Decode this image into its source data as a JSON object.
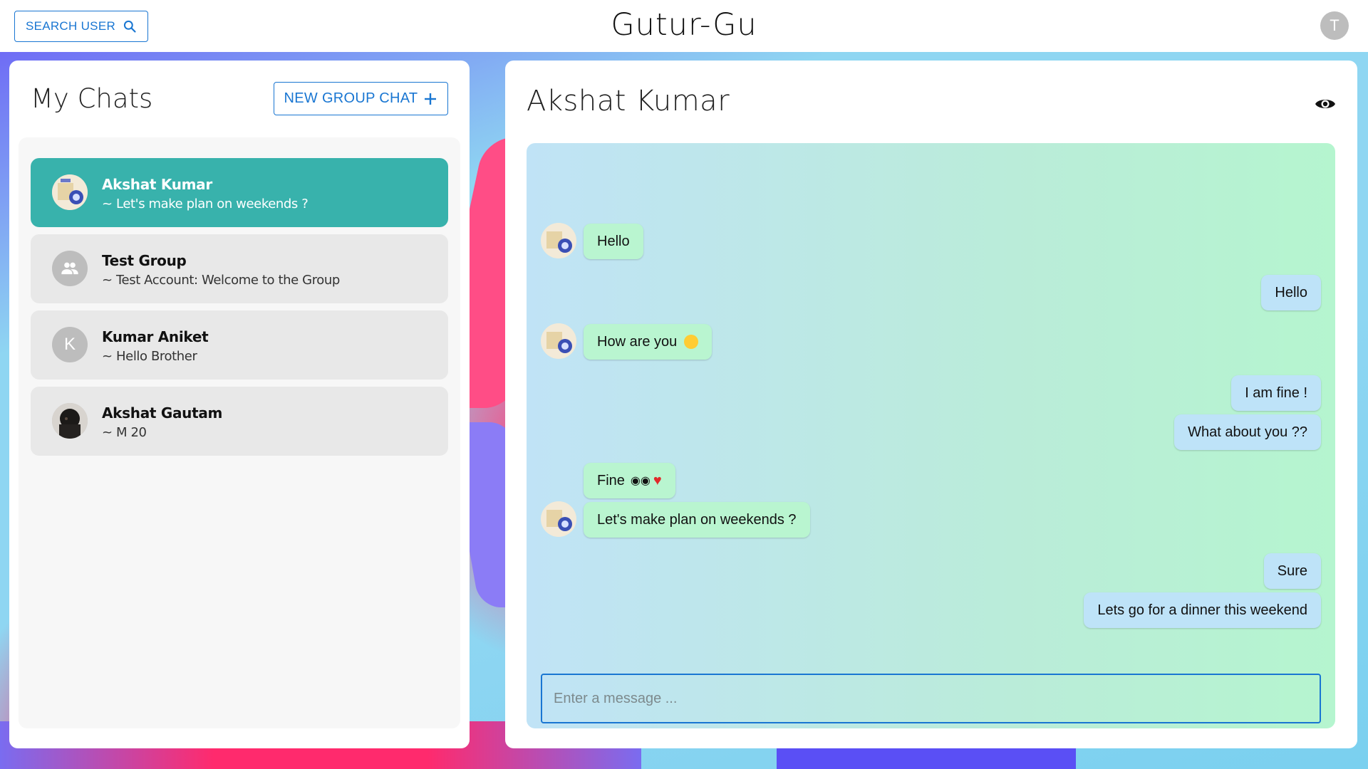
{
  "topbar": {
    "search_button_label": "SEARCH USER",
    "app_title": "Gutur-Gu",
    "user_avatar_initial": "T"
  },
  "sidebar": {
    "title": "My Chats",
    "new_group_button_label": "NEW GROUP CHAT",
    "chats": [
      {
        "name": "Akshat Kumar",
        "last_message": "~ Let's make plan on weekends ?",
        "avatar": "photo-avatar",
        "active": true
      },
      {
        "name": "Test Group",
        "last_message": "~ Test Account: Welcome to the Group",
        "avatar": "group-icon",
        "active": false
      },
      {
        "name": "Kumar Aniket",
        "last_message": "~ Hello Brother",
        "avatar_initial": "K",
        "active": false
      },
      {
        "name": "Akshat Gautam",
        "last_message": "~ M 20",
        "avatar": "photo-avatar-dark",
        "active": false
      }
    ]
  },
  "chat": {
    "title": "Akshat Kumar",
    "input_placeholder": "Enter a message ...",
    "messages": [
      {
        "sender": "other",
        "text": "Hello"
      },
      {
        "sender": "me",
        "text": "Hello"
      },
      {
        "sender": "other",
        "text": "How are you",
        "emoji": "smiling-face"
      },
      {
        "sender": "me",
        "text": "I am fine !"
      },
      {
        "sender": "me",
        "text": "What about you ??"
      },
      {
        "sender": "other",
        "text": "Fine",
        "emoji": "eyes, red-heart"
      },
      {
        "sender": "other",
        "text": "Let's make plan on weekends ?"
      },
      {
        "sender": "me",
        "text": "Sure"
      },
      {
        "sender": "me",
        "text": "Lets go for a dinner this weekend"
      }
    ]
  },
  "colors": {
    "accent": "#1976d2",
    "active_chat": "#38b2ac",
    "incoming_bubble": "#b9f5d0",
    "outgoing_bubble": "#bee3f8"
  }
}
